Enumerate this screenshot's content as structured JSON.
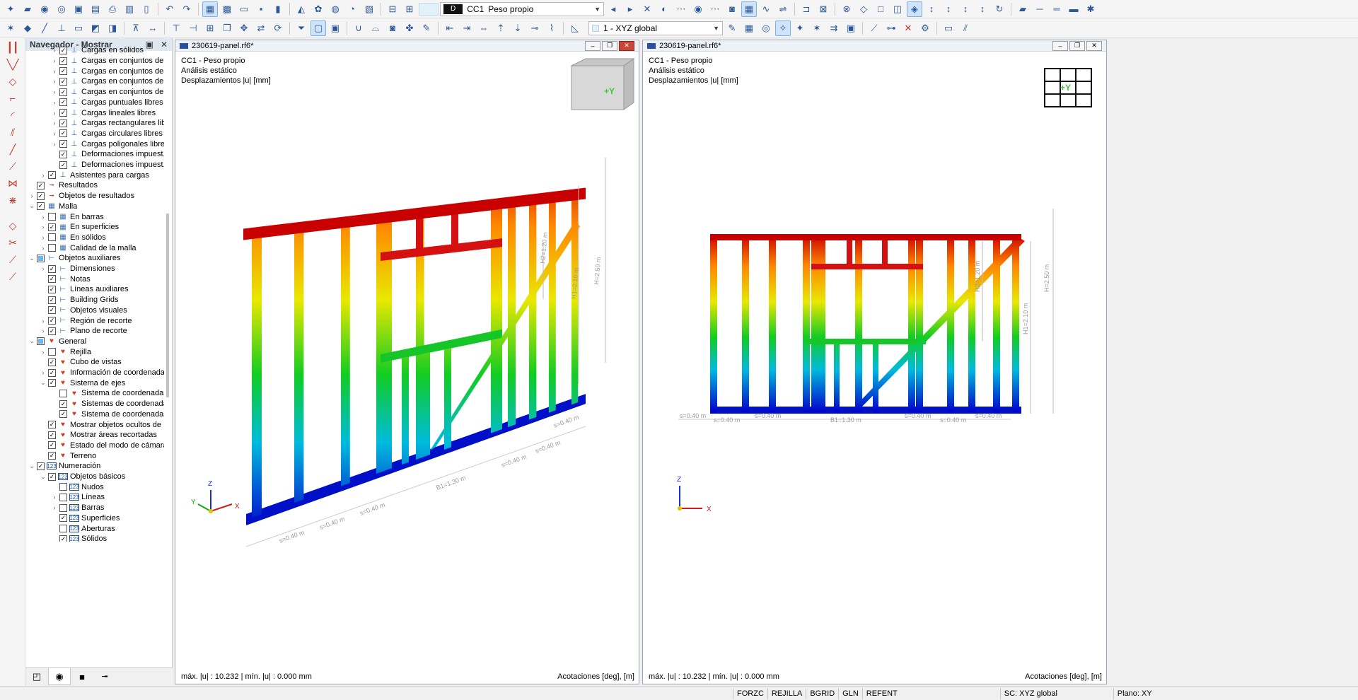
{
  "toolbar": {
    "load_case_tag": "D",
    "load_case_code": "CC1",
    "load_case_name": "Peso propio",
    "coord_system": "1 - XYZ global"
  },
  "navigator": {
    "title": "Navegador - Mostrar",
    "items": [
      {
        "label": "Cargas en sólidos",
        "indent": 3,
        "exp": ">",
        "check": "v",
        "icon": "load"
      },
      {
        "label": "Cargas en conjuntos de ...",
        "indent": 3,
        "exp": ">",
        "check": "v",
        "icon": "load"
      },
      {
        "label": "Cargas en conjuntos de ...",
        "indent": 3,
        "exp": ">",
        "check": "v",
        "icon": "load"
      },
      {
        "label": "Cargas en conjuntos de ...",
        "indent": 3,
        "exp": ">",
        "check": "v",
        "icon": "load"
      },
      {
        "label": "Cargas en conjuntos de ...",
        "indent": 3,
        "exp": ">",
        "check": "v",
        "icon": "load"
      },
      {
        "label": "Cargas puntuales libres",
        "indent": 3,
        "exp": ">",
        "check": "v",
        "icon": "load"
      },
      {
        "label": "Cargas lineales libres",
        "indent": 3,
        "exp": ">",
        "check": "v",
        "icon": "load"
      },
      {
        "label": "Cargas rectangulares lib...",
        "indent": 3,
        "exp": ">",
        "check": "v",
        "icon": "load"
      },
      {
        "label": "Cargas circulares libres",
        "indent": 3,
        "exp": ">",
        "check": "v",
        "icon": "load"
      },
      {
        "label": "Cargas poligonales libres",
        "indent": 3,
        "exp": ">",
        "check": "v",
        "icon": "load"
      },
      {
        "label": "Deformaciones impuest...",
        "indent": 3,
        "exp": "",
        "check": "v",
        "icon": "load"
      },
      {
        "label": "Deformaciones impuest...",
        "indent": 3,
        "exp": "",
        "check": "v",
        "icon": "load"
      },
      {
        "label": "Asistentes para cargas",
        "indent": 2,
        "exp": ">",
        "check": "v",
        "icon": "load"
      },
      {
        "label": "Resultados",
        "indent": 1,
        "exp": "",
        "check": "v",
        "icon": "result"
      },
      {
        "label": "Objetos de resultados",
        "indent": 1,
        "exp": ">",
        "check": "v",
        "icon": "result"
      },
      {
        "label": "Malla",
        "indent": 1,
        "exp": "v",
        "check": "v",
        "icon": "mesh"
      },
      {
        "label": "En barras",
        "indent": 2,
        "exp": ">",
        "check": "",
        "icon": "mesh"
      },
      {
        "label": "En superficies",
        "indent": 2,
        "exp": ">",
        "check": "v",
        "icon": "mesh"
      },
      {
        "label": "En sólidos",
        "indent": 2,
        "exp": ">",
        "check": "",
        "icon": "mesh"
      },
      {
        "label": "Calidad de la malla",
        "indent": 2,
        "exp": ">",
        "check": "",
        "icon": "mesh"
      },
      {
        "label": "Objetos auxiliares",
        "indent": 1,
        "exp": "v",
        "check": "sq",
        "icon": "aux"
      },
      {
        "label": "Dimensiones",
        "indent": 2,
        "exp": ">",
        "check": "v",
        "icon": "aux"
      },
      {
        "label": "Notas",
        "indent": 2,
        "exp": "",
        "check": "v",
        "icon": "aux"
      },
      {
        "label": "Líneas auxiliares",
        "indent": 2,
        "exp": "",
        "check": "v",
        "icon": "aux"
      },
      {
        "label": "Building Grids",
        "indent": 2,
        "exp": "",
        "check": "v",
        "icon": "aux"
      },
      {
        "label": "Objetos visuales",
        "indent": 2,
        "exp": "",
        "check": "v",
        "icon": "aux"
      },
      {
        "label": "Región de recorte",
        "indent": 2,
        "exp": ">",
        "check": "v",
        "icon": "aux"
      },
      {
        "label": "Plano de recorte",
        "indent": 2,
        "exp": ">",
        "check": "v",
        "icon": "aux"
      },
      {
        "label": "General",
        "indent": 1,
        "exp": "v",
        "check": "sq",
        "icon": "heart"
      },
      {
        "label": "Rejilla",
        "indent": 2,
        "exp": ">",
        "check": "",
        "icon": "heart"
      },
      {
        "label": "Cubo de vistas",
        "indent": 2,
        "exp": "",
        "check": "v",
        "icon": "heart"
      },
      {
        "label": "Información de coordenada...",
        "indent": 2,
        "exp": ">",
        "check": "v",
        "icon": "heart"
      },
      {
        "label": "Sistema de ejes",
        "indent": 2,
        "exp": "v",
        "check": "v",
        "icon": "heart"
      },
      {
        "label": "Sistema de coordenadas...",
        "indent": 3,
        "exp": "",
        "check": "",
        "icon": "heart"
      },
      {
        "label": "Sistemas de coordenada...",
        "indent": 3,
        "exp": "",
        "check": "v",
        "icon": "heart"
      },
      {
        "label": "Sistema de coordenadas...",
        "indent": 3,
        "exp": "",
        "check": "v",
        "icon": "heart"
      },
      {
        "label": "Mostrar objetos ocultos de ...",
        "indent": 2,
        "exp": "",
        "check": "v",
        "icon": "heart"
      },
      {
        "label": "Mostrar áreas recortadas",
        "indent": 2,
        "exp": "",
        "check": "v",
        "icon": "heart"
      },
      {
        "label": "Estado del modo de cámara ...",
        "indent": 2,
        "exp": "",
        "check": "v",
        "icon": "heart"
      },
      {
        "label": "Terreno",
        "indent": 2,
        "exp": "",
        "check": "v",
        "icon": "heart"
      },
      {
        "label": "Numeración",
        "indent": 1,
        "exp": "v",
        "check": "v",
        "icon": "num"
      },
      {
        "label": "Objetos básicos",
        "indent": 2,
        "exp": "v",
        "check": "v",
        "icon": "num"
      },
      {
        "label": "Nudos",
        "indent": 3,
        "exp": "",
        "check": "",
        "icon": "num"
      },
      {
        "label": "Líneas",
        "indent": 3,
        "exp": ">",
        "check": "",
        "icon": "num"
      },
      {
        "label": "Barras",
        "indent": 3,
        "exp": ">",
        "check": "",
        "icon": "num"
      },
      {
        "label": "Superficies",
        "indent": 3,
        "exp": "",
        "check": "v",
        "icon": "num"
      },
      {
        "label": "Aberturas",
        "indent": 3,
        "exp": "",
        "check": "",
        "icon": "num"
      },
      {
        "label": "Sólidos",
        "indent": 3,
        "exp": "",
        "check": "v",
        "icon": "num"
      }
    ]
  },
  "views": {
    "left": {
      "title": "230619-panel.rf6*",
      "line1": "CC1 - Peso propio",
      "line2": "Análisis estático",
      "line3": "Desplazamientos |u| [mm]",
      "footer_left": "máx. |u| : 10.232 | mín. |u| : 0.000 mm",
      "footer_right": "Acotaciones [deg], [m]",
      "cube_label": "+Y",
      "dims": {
        "s": "s=0.40 m",
        "b1": "B1=1.30 m",
        "h1": "H1=2.10 m",
        "h2": "H2=1.20 m",
        "h": "H=2.50 m"
      },
      "axes": {
        "x": "X",
        "y": "Y",
        "z": "Z"
      }
    },
    "right": {
      "title": "230619-panel.rf6*",
      "line1": "CC1 - Peso propio",
      "line2": "Análisis estático",
      "line3": "Desplazamientos |u| [mm]",
      "footer_left": "máx. |u| : 10.232 | mín. |u| : 0.000 mm",
      "footer_right": "Acotaciones [deg], [m]",
      "cube_label": "+Y",
      "dims": {
        "s": "s=0.40 m",
        "b1": "B1=1.30 m",
        "h1": "H1=2.10 m",
        "h2": "H2=1.20 m",
        "h": "H=2.50 m"
      },
      "axes": {
        "x": "X",
        "z": "Z"
      }
    }
  },
  "statusbar": {
    "buttons": [
      "FORZC",
      "REJILLA",
      "BGRID",
      "GLN",
      "REFENT"
    ],
    "cs": "SC: XYZ global",
    "plane": "Plano: XY"
  },
  "colors": {
    "max": "#cc0000",
    "high": "#ff8800",
    "mid": "#e8e800",
    "green": "#11cc22",
    "cyan": "#00bbdd",
    "low": "#0000cc"
  }
}
